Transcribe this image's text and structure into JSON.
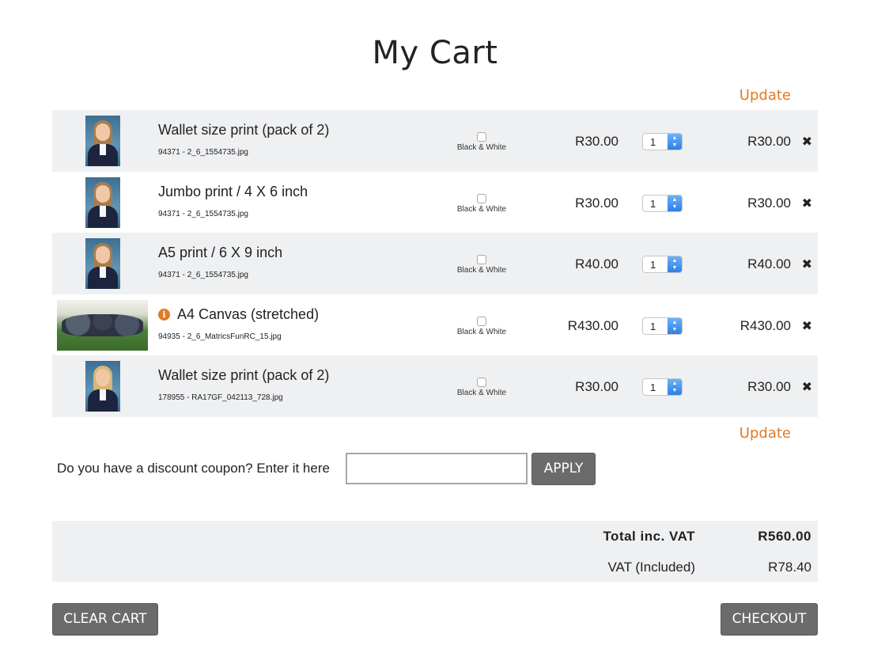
{
  "page": {
    "title": "My Cart"
  },
  "cart": {
    "update_label": "Update",
    "items": [
      {
        "name": "Wallet size print (pack of 2)",
        "file": "94371 - 2_6_1554735.jpg",
        "bw_label": "Black & White",
        "price": "R30.00",
        "qty": "1",
        "total": "R30.00",
        "image": "portrait",
        "info": false
      },
      {
        "name": "Jumbo print / 4 X 6 inch",
        "file": "94371 - 2_6_1554735.jpg",
        "bw_label": "Black & White",
        "price": "R30.00",
        "qty": "1",
        "total": "R30.00",
        "image": "portrait",
        "info": false
      },
      {
        "name": "A5 print / 6 X 9 inch",
        "file": "94371 - 2_6_1554735.jpg",
        "bw_label": "Black & White",
        "price": "R40.00",
        "qty": "1",
        "total": "R40.00",
        "image": "portrait",
        "info": false
      },
      {
        "name": "A4 Canvas (stretched)",
        "file": "94935 - 2_6_MatricsFunRC_15.jpg",
        "bw_label": "Black & White",
        "price": "R430.00",
        "qty": "1",
        "total": "R430.00",
        "image": "group",
        "info": true,
        "info_glyph": "i"
      },
      {
        "name": "Wallet size print (pack of 2)",
        "file": "178955 - RA17GF_042113_728.jpg",
        "bw_label": "Black & White",
        "price": "R30.00",
        "qty": "1",
        "total": "R30.00",
        "image": "portrait-blonde",
        "info": false
      }
    ],
    "remove_glyph": "✖",
    "spin_up": "▲",
    "spin_down": "▼"
  },
  "coupon": {
    "label": "Do you have a discount coupon? Enter it here",
    "value": "",
    "apply_label": "APPLY"
  },
  "totals": {
    "total_label": "Total inc. VAT",
    "total_value": "R560.00",
    "vat_label": "VAT (Included)",
    "vat_value": "R78.40"
  },
  "actions": {
    "clear_label": "CLEAR CART",
    "checkout_label": "CHECKOUT"
  },
  "colors": {
    "accent": "#e07b24",
    "button": "#6b6b6b",
    "row_shade": "#eff0f2"
  }
}
